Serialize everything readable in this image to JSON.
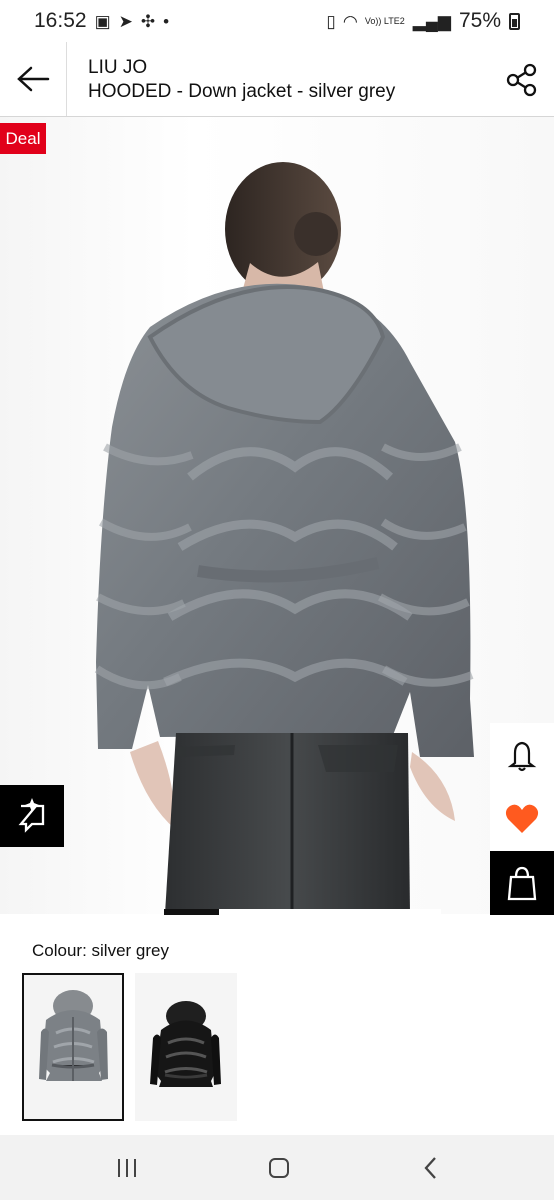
{
  "status": {
    "time": "16:52",
    "battery": "75%",
    "network_label": "Vo)) LTE2"
  },
  "appbar": {
    "brand": "LIU JO",
    "product": "HOODED - Down jacket - silver grey"
  },
  "product": {
    "badge": "Deal",
    "colour_label": "Colour: silver grey",
    "gallery_progress": 0.2
  },
  "icons": {
    "back": "back-arrow-icon",
    "share": "share-icon",
    "ai": "visual-search-icon",
    "notify": "bell-icon",
    "favourite": "heart-icon",
    "bag": "shopping-bag-icon"
  },
  "colors": {
    "deal": "#e1001a",
    "favourite": "#ff5a1f",
    "black": "#000000"
  }
}
